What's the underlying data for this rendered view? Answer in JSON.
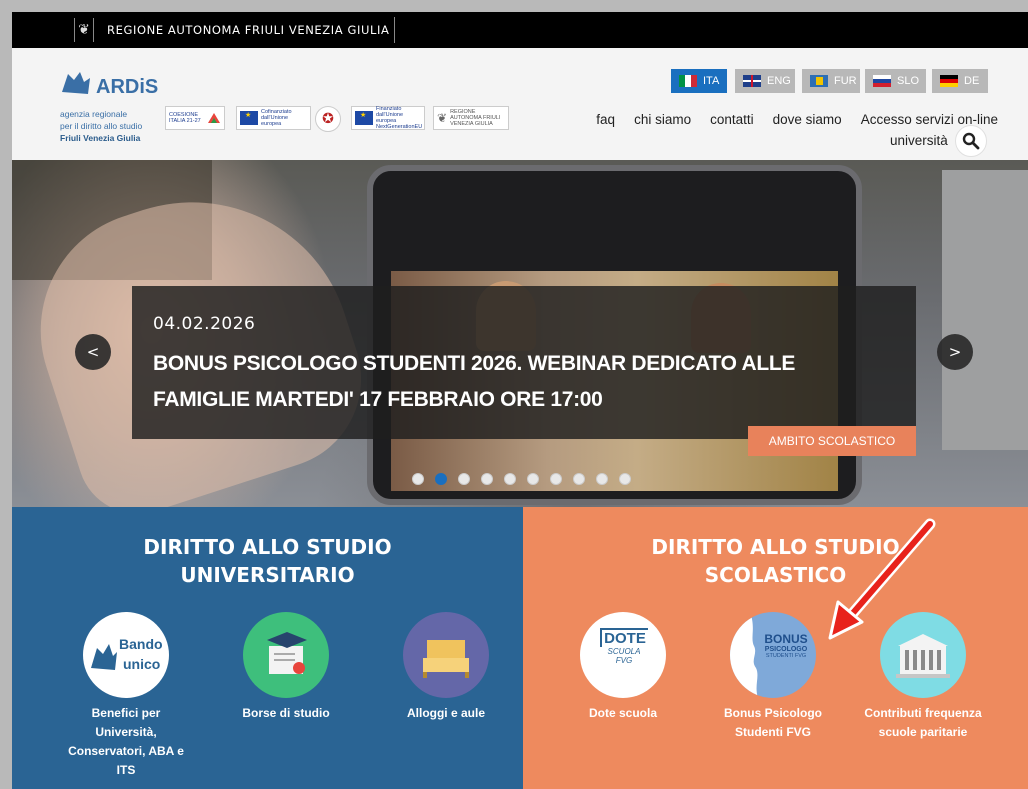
{
  "regione_bar": {
    "text": "REGIONE AUTONOMA FRIULI VENEZIA GIULIA"
  },
  "logo": {
    "name": "ARDiS",
    "subtitle_lines": [
      "agenzia regionale",
      "per il diritto allo studio",
      "Friuli Venezia Giulia"
    ]
  },
  "partners": [
    {
      "text": "COESIONE ITALIA 21-27"
    },
    {
      "text": "Cofinanziato dall'Unione europea"
    },
    {
      "text": "Finanziato dall'Unione europea NextGenerationEU"
    },
    {
      "text": "REGIONE AUTONOMA FRIULI VENEZIA GIULIA"
    }
  ],
  "languages": [
    {
      "code": "ITA",
      "active": true
    },
    {
      "code": "ENG",
      "active": false
    },
    {
      "code": "FUR",
      "active": false
    },
    {
      "code": "SLO",
      "active": false
    },
    {
      "code": "DE",
      "active": false
    }
  ],
  "nav": {
    "items": [
      "faq",
      "chi siamo",
      "contatti",
      "dove siamo",
      "Accesso servizi on-line"
    ],
    "second_line": "università"
  },
  "hero": {
    "date": "04.02.2026",
    "title": "BONUS PSICOLOGO STUDENTI 2026. WEBINAR DEDICATO ALLE FAMIGLIE MARTEDI' 17 FEBBRAIO ORE 17:00",
    "tag": "AMBITO SCOLASTICO",
    "prev": "<",
    "next": ">",
    "slide_count": 10,
    "active_slide": 2
  },
  "panels": {
    "left": {
      "title_line1": "DIRITTO ALLO STUDIO",
      "title_line2": "UNIVERSITARIO",
      "services": [
        {
          "icon_text_1": "Bando",
          "icon_text_2": "unico",
          "label": "Benefici per Università, Conservatori, ABA e ITS"
        },
        {
          "label": "Borse di studio"
        },
        {
          "label": "Alloggi e aule"
        }
      ]
    },
    "right": {
      "title_line1": "DIRITTO ALLO STUDIO",
      "title_line2": "SCOLASTICO",
      "services": [
        {
          "icon_text_1": "DOTE",
          "icon_text_2": "SCUOLA",
          "icon_text_3": "FVG",
          "label": "Dote scuola"
        },
        {
          "icon_text_1": "BONUS",
          "icon_text_2": "PSICOLOGO",
          "icon_text_3": "STUDENTI FVG",
          "label": "Bonus Psicologo Studenti FVG"
        },
        {
          "label": "Contributi frequenza scuole paritarie"
        }
      ]
    }
  },
  "colors": {
    "brand_blue": "#2a6494",
    "accent_orange": "#ee8a5e",
    "tag_orange": "#e8825b",
    "lang_active": "#1a6fbf",
    "annotation_red": "#e8221b"
  }
}
